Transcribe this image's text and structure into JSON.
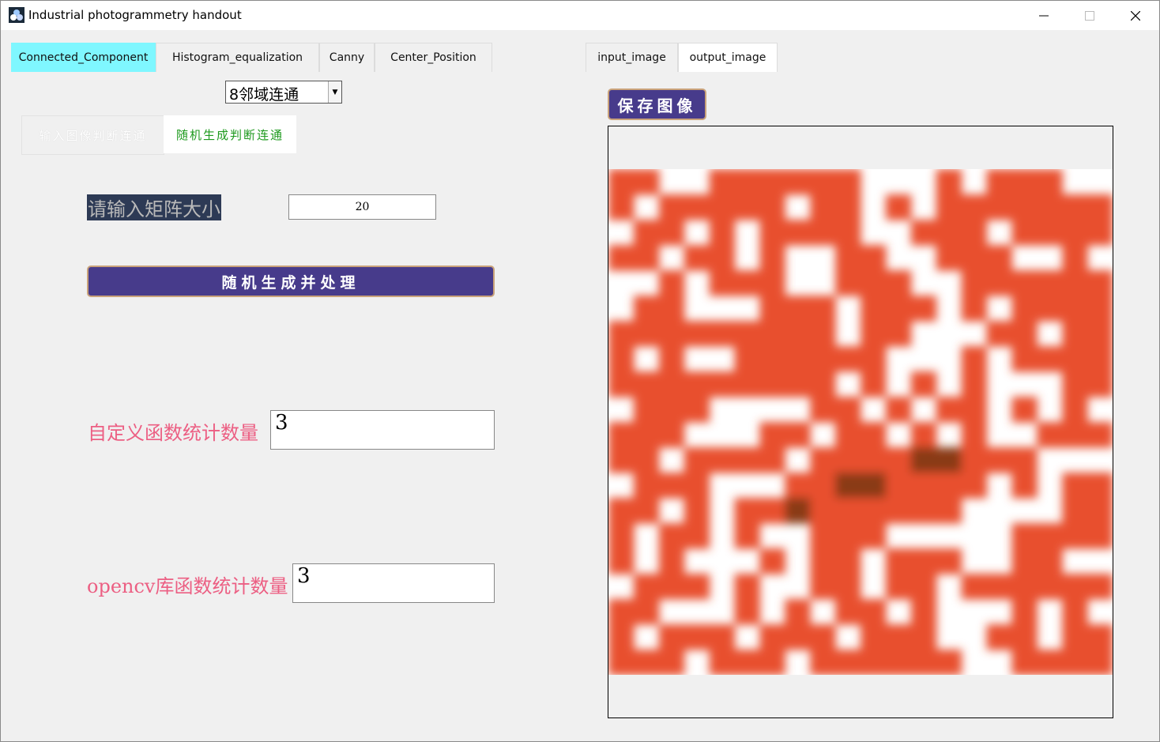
{
  "window": {
    "title": "Industrial photogrammetry handout",
    "controls": {
      "minimize": "─",
      "maximize": "☐",
      "close": "✕"
    }
  },
  "left_tabs": [
    {
      "label": "Connected_Component",
      "active": true
    },
    {
      "label": "Histogram_equalization",
      "active": false
    },
    {
      "label": "Canny",
      "active": false
    },
    {
      "label": "Center_Position",
      "active": false
    }
  ],
  "right_tabs": [
    {
      "label": "input_image",
      "active": false
    },
    {
      "label": "output_image",
      "active": true
    }
  ],
  "connectivity_select": {
    "value": "8邻域连通"
  },
  "sub_tabs": [
    {
      "label": "输入图像判断连通",
      "active": false
    },
    {
      "label": "随机生成判断连通",
      "active": true
    }
  ],
  "matrix": {
    "label": "请输入矩阵大小",
    "value": "20"
  },
  "generate_button": "随机生成并处理",
  "custom_count": {
    "label": "自定义函数统计数量",
    "value": "3"
  },
  "opencv_count": {
    "label": "opencv库函数统计数量",
    "value": "3"
  },
  "save_button": "保存图像",
  "colors": {
    "active_tab": "#7ff7ff",
    "button_bg": "#473b8b",
    "button_border": "#c9a27a",
    "label_pink": "#ec5f83",
    "subtab_green": "#1f9a1f",
    "component_orange": "#e8502f",
    "component_dark": "#8a3a18"
  },
  "output_grid": {
    "size": 20,
    "legend": "1 = orange component, 2 = dark component, 0 = background",
    "rows": [
      "11001111110001011100",
      "10111110110101111111",
      "01101011110011101111",
      "11011010011001110010",
      "00101110011100111111",
      "01100011101110101111",
      "11111111101100011011",
      "10100111111000101111",
      "11111111101010100011",
      "01110000110101101010",
      "11100011011010100111",
      "11011110111122111000",
      "01110001122111101011",
      "11010112111111000011",
      "10110100111000001111",
      "10100010110111001100",
      "01110100110110111111",
      "11000101011010001010",
      "10111011101110011011",
      "11101110111111001111"
    ]
  }
}
